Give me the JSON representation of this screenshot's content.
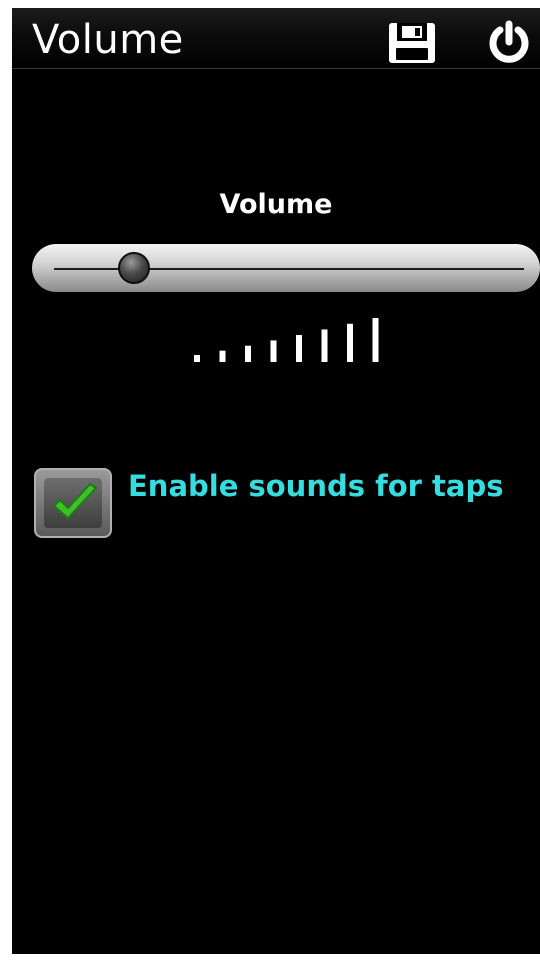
{
  "header": {
    "title": "Volume",
    "save_icon": "floppy-disk-icon",
    "power_icon": "power-icon"
  },
  "volume": {
    "label": "Volume",
    "level": 0.17,
    "bar_count": 8,
    "active_bars": 8
  },
  "sound_option": {
    "label": "Enable sounds for taps",
    "checked": true,
    "check_icon": "checkmark-icon"
  },
  "colors": {
    "background": "#000000",
    "label_accent": "#33dde0",
    "check_green": "#3fbf2a"
  }
}
